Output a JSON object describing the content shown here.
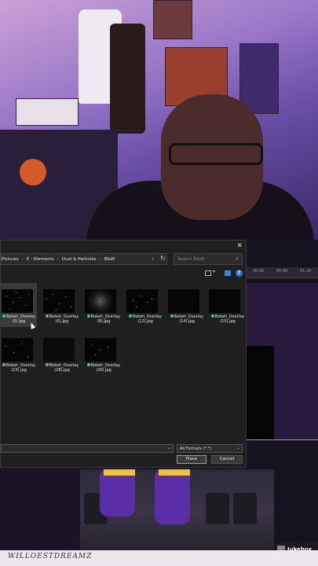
{
  "dialog": {
    "breadcrumb": [
      "Pictures",
      "E - Elements",
      "Dust & Particles",
      "B&W"
    ],
    "search_placeholder": "Search B&W",
    "file_types": "All Formats (*.*)",
    "place_label": "Place",
    "cancel_label": "Cancel",
    "files": [
      {
        "name": "Bokeh_Overlay (5).jpg",
        "selected": true
      },
      {
        "name": "Bokeh_Overlay (6).jpg",
        "selected": false
      },
      {
        "name": "Bokeh_Overlay (8).jpg",
        "selected": false
      },
      {
        "name": "Bokeh_Overlay (12).jpg",
        "selected": false
      },
      {
        "name": "Bokeh_Overlay (14).jpg",
        "selected": false
      },
      {
        "name": "Bokeh_Overlay (15).jpg",
        "selected": false
      },
      {
        "name": "Bokeh_Overlay (23).jpg",
        "selected": false
      },
      {
        "name": "Bokeh_Overlay (28).jpg",
        "selected": false
      },
      {
        "name": "Bokeh_Overlay (30).jpg",
        "selected": false
      }
    ]
  },
  "editor": {
    "ruler_labels": [
      "00:00",
      "00:40",
      "01:20"
    ]
  },
  "overlay": {
    "jukebox_label": "Jukebox",
    "brand_text": "WILLOESTDREAMZ"
  }
}
